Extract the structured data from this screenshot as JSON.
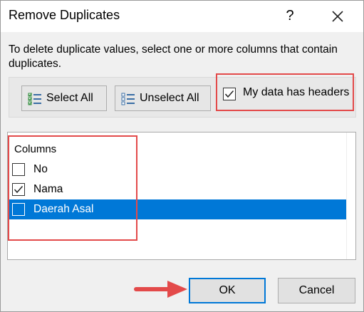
{
  "dialog": {
    "title": "Remove Duplicates",
    "help_label": "?",
    "instructions": "To delete duplicate values, select one or more columns that contain duplicates."
  },
  "toolbar": {
    "select_all_label": "Select All",
    "unselect_all_label": "Unselect All",
    "headers_label": "My data has headers",
    "headers_checked": true
  },
  "columns": {
    "header": "Columns",
    "items": [
      {
        "label": "No",
        "checked": false,
        "selected": false
      },
      {
        "label": "Nama",
        "checked": true,
        "selected": false
      },
      {
        "label": "Daerah Asal",
        "checked": false,
        "selected": true
      }
    ]
  },
  "footer": {
    "ok_label": "OK",
    "cancel_label": "Cancel"
  },
  "colors": {
    "accent": "#0078d7",
    "highlight": "#e34a4a"
  },
  "icons": [
    "close-icon",
    "select-all-icon",
    "unselect-all-icon",
    "checkmark-icon",
    "arrow-icon"
  ]
}
